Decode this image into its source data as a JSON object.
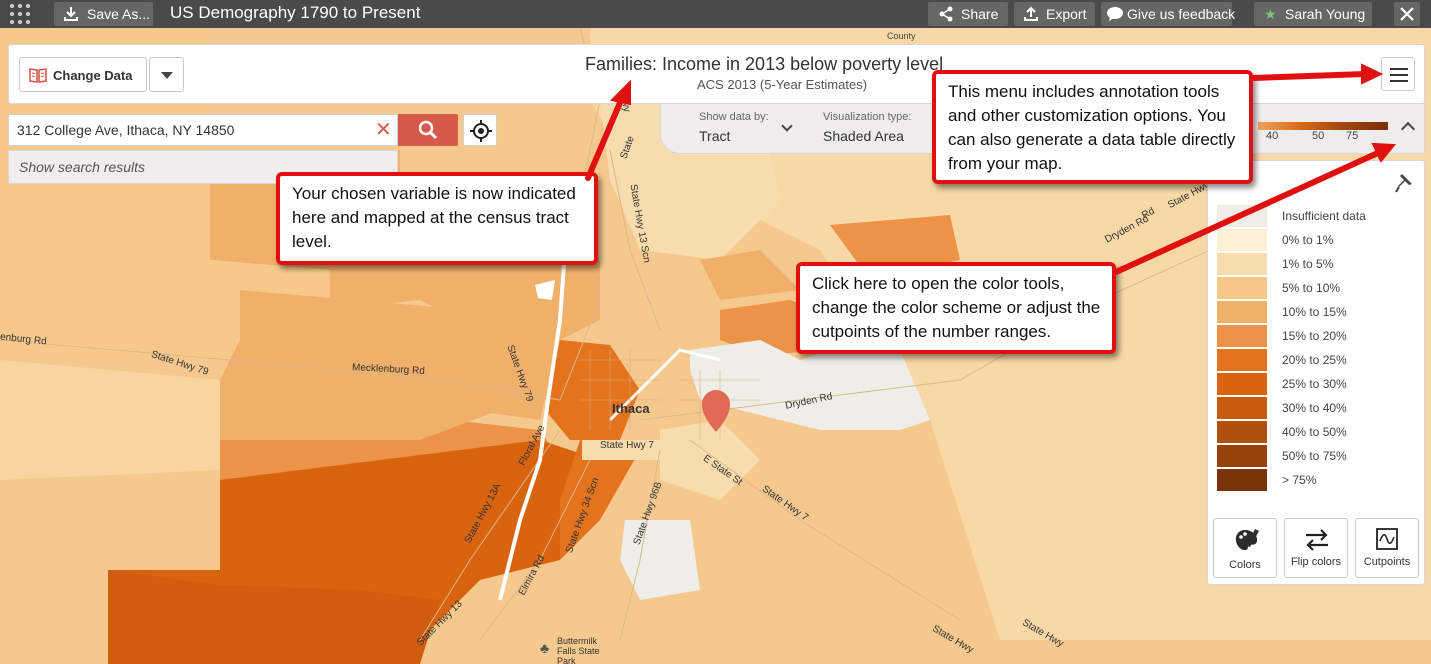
{
  "topbar": {
    "save_label": "Save As...",
    "app_title": "US Demography 1790 to Present",
    "share_label": "Share",
    "export_label": "Export",
    "feedback_label": "Give us feedback",
    "user_name": "Sarah Young"
  },
  "header": {
    "change_data_label": "Change Data",
    "title": "Families: Income in 2013 below poverty level",
    "subtitle": "ACS 2013 (5-Year Estimates)"
  },
  "search": {
    "value": "312 College Ave, Ithaca, NY 14850",
    "results_label": "Show search results"
  },
  "options": {
    "show_by_label": "Show data by:",
    "show_by_value": "Tract",
    "vis_type_label": "Visualization type:",
    "vis_type_value": "Shaded Area",
    "scale_labels": [
      "40",
      "50",
      "75"
    ]
  },
  "legend": {
    "items": [
      {
        "label": "Insufficient data",
        "color": "#efede8"
      },
      {
        "label": "0% to 1%",
        "color": "#fdf0d6"
      },
      {
        "label": "1% to 5%",
        "color": "#f9dcae"
      },
      {
        "label": "5% to 10%",
        "color": "#f6c98a"
      },
      {
        "label": "10% to 15%",
        "color": "#f1b06a"
      },
      {
        "label": "15% to 20%",
        "color": "#ec9347"
      },
      {
        "label": "20% to 25%",
        "color": "#e4731e"
      },
      {
        "label": "25% to 30%",
        "color": "#d9640f"
      },
      {
        "label": "30% to 40%",
        "color": "#c75a0d"
      },
      {
        "label": "40% to 50%",
        "color": "#b0500c"
      },
      {
        "label": "50% to 75%",
        "color": "#96420a"
      },
      {
        "label": "> 75%",
        "color": "#7a3306"
      }
    ],
    "colors_label": "Colors",
    "flip_label": "Flip colors",
    "cutpoints_label": "Cutpoints"
  },
  "map_labels": {
    "city": "Ithaca",
    "county": "County",
    "park": [
      "Buttermilk",
      "Falls State",
      "Park"
    ],
    "roads": {
      "mecklenburg": "Mecklenburg Rd",
      "enburg": "enburg Rd",
      "hwy79_w": "State Hwy 79",
      "hwy79_c": "State Hwy 79",
      "hwy7": "State Hwy 7",
      "dryden_1": "Dryden Rd",
      "dryden_2": "Dryden Rd",
      "e_state": "E State St",
      "state_hwy_e": "State Hwy 7",
      "hwy96b": "State Hwy 96B",
      "hwy13a": "State Hwy 13A",
      "floral": "Floral Ave",
      "hwy34": "State Hwy 34 Scn",
      "elmira": "Elmira Rd",
      "hwy13_n": "State Hwy 13 Scn",
      "state_n": "State",
      "state_hwy_n": "State Hwy",
      "rd_ne": "Rd",
      "state_hwy_ne": "State Hwy",
      "hwy13_sw": "State Hwy 13",
      "state_hwy_se": "State Hwy",
      "state_hwy_se2": "State Hwy"
    }
  },
  "callouts": {
    "variable": "Your chosen variable is now indicated here and mapped at the census tract level.",
    "menu": "This menu includes annotation tools and other customization options. You can also generate a data table directly from your map.",
    "color": "Click here to open the color tools, change the color scheme or adjust the cutpoints of the number ranges."
  },
  "colors": {
    "topbar": "#4a4a4a",
    "accent": "#d65a4a",
    "callout_border": "#e01010",
    "user_star": "#7bc87b"
  }
}
